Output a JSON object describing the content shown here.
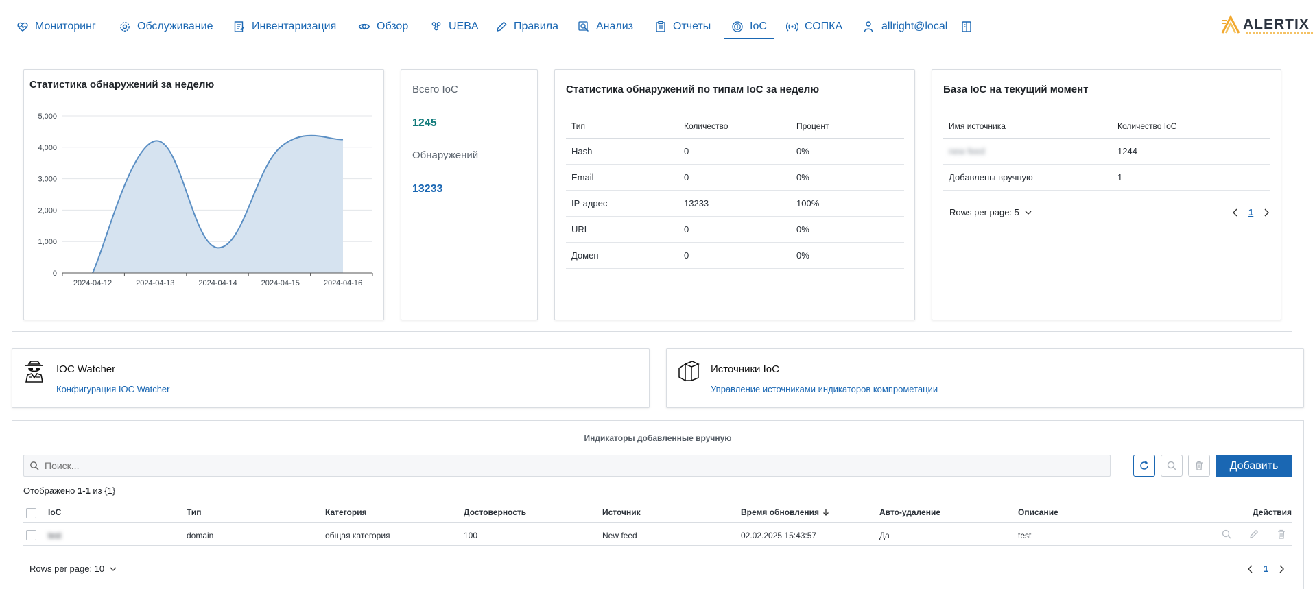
{
  "nav": {
    "items": [
      {
        "label": "Мониторинг",
        "icon": "heart-pulse-icon"
      },
      {
        "label": "Обслуживание",
        "icon": "gear-icon"
      },
      {
        "label": "Инвентаризация",
        "icon": "edit-list-icon"
      },
      {
        "label": "Обзор",
        "icon": "eye-icon"
      },
      {
        "label": "UEBA",
        "icon": "users-icon"
      },
      {
        "label": "Правила",
        "icon": "pencil-icon"
      },
      {
        "label": "Анализ",
        "icon": "magnify-icon"
      },
      {
        "label": "Отчеты",
        "icon": "clipboard-icon"
      },
      {
        "label": "IoC",
        "icon": "fingerprint-icon"
      },
      {
        "label": "СОПКА",
        "icon": "broadcast-icon"
      },
      {
        "label": "allright@local",
        "icon": "user-lock-icon"
      }
    ],
    "active": "IoC",
    "panel_icon": "book-icon",
    "logo_text": "ALERTIX",
    "accent": "#1a67b3"
  },
  "weekly_chart": {
    "title": "Статистика обнаружений за неделю"
  },
  "chart_data": {
    "type": "area",
    "x": [
      "2024-04-12",
      "2024-04-13",
      "2024-04-14",
      "2024-04-15",
      "2024-04-16"
    ],
    "series": [
      {
        "values": [
          0,
          4200,
          800,
          4000,
          4250
        ]
      }
    ],
    "ylim": [
      0,
      5000
    ],
    "yticks": [
      "0",
      "1,000",
      "2,000",
      "3,000",
      "4,000",
      "5,000"
    ],
    "grid": true,
    "fill_color": "#d6e3f0",
    "line_color": "#5b8fc4"
  },
  "totals": {
    "ioc_label": "Всего IoC",
    "ioc_value": "1245",
    "ioc_color": "#0f7a7a",
    "detections_label": "Обнаружений",
    "detections_value": "13233",
    "detections_color": "#1a67b3"
  },
  "types_table": {
    "title": "Статистика обнаружений по типам IoC за неделю",
    "headers": [
      "Тип",
      "Количество",
      "Процент"
    ],
    "rows": [
      [
        "Hash",
        "0",
        "0%"
      ],
      [
        "Email",
        "0",
        "0%"
      ],
      [
        "IP-адрес",
        "13233",
        "100%"
      ],
      [
        "URL",
        "0",
        "0%"
      ],
      [
        "Домен",
        "0",
        "0%"
      ]
    ]
  },
  "base_table": {
    "title": "База IoC на текущий момент",
    "headers": [
      "Имя источника",
      "Количество IoC"
    ],
    "rows": [
      [
        "new feed",
        "1244"
      ],
      [
        "Добавлены вручную",
        "1"
      ]
    ],
    "rows_per_page": "Rows per page: 5",
    "page": "1"
  },
  "watcher": {
    "title": "IOC Watcher",
    "link": "Конфигурация IOC Watcher"
  },
  "sources": {
    "title": "Источники IoC",
    "link": "Управление источниками индикаторов компрометации"
  },
  "manual": {
    "section_title": "Индикаторы добавленные вручную",
    "search_placeholder": "Поиск...",
    "add_label": "Добавить",
    "shown_prefix": "Отображено ",
    "shown_range": "1-1",
    "shown_suffix": " из {1}",
    "columns": [
      "IoC",
      "Тип",
      "Категория",
      "Достоверность",
      "Источник",
      "Время обновления",
      "Авто-удаление",
      "Описание",
      "Действия"
    ],
    "rows": [
      {
        "ioc": "test",
        "type": "domain",
        "category": "общая категория",
        "confidence": "100",
        "source": "New feed",
        "updated": "02.02.2025 15:43:57",
        "auto_delete": "Да",
        "description": "test"
      }
    ],
    "rows_per_page": "Rows per page: 10",
    "page": "1"
  }
}
